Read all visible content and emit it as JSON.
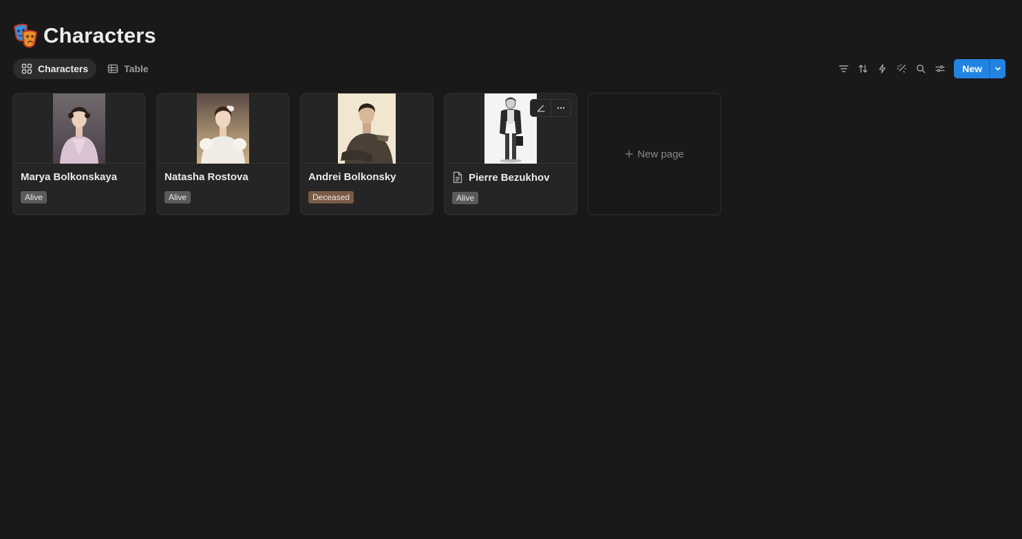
{
  "page": {
    "title": "Characters",
    "icon": "theater-masks-icon"
  },
  "views": [
    {
      "label": "Characters",
      "icon": "gallery-icon",
      "active": true
    },
    {
      "label": "Table",
      "icon": "table-icon",
      "active": false
    }
  ],
  "toolbar": {
    "icons": [
      "filter-icon",
      "sort-icon",
      "automation-icon",
      "ai-sparkle-icon",
      "search-icon",
      "settings-icon"
    ],
    "new_label": "New"
  },
  "cards": [
    {
      "title": "Marya Bolkonskaya",
      "status": "Alive",
      "status_color": "#5a5a5a",
      "cover": "portrait-woman-lilac"
    },
    {
      "title": "Natasha Rostova",
      "status": "Alive",
      "status_color": "#5a5a5a",
      "cover": "portrait-woman-white-dress"
    },
    {
      "title": "Andrei Bolkonsky",
      "status": "Deceased",
      "status_color": "#7a5a45",
      "cover": "sketch-seated-man"
    },
    {
      "title": "Pierre Bezukhov",
      "status": "Alive",
      "status_color": "#5a5a5a",
      "cover": "sketch-standing-man",
      "hovered": true
    }
  ],
  "new_page_label": "New page"
}
